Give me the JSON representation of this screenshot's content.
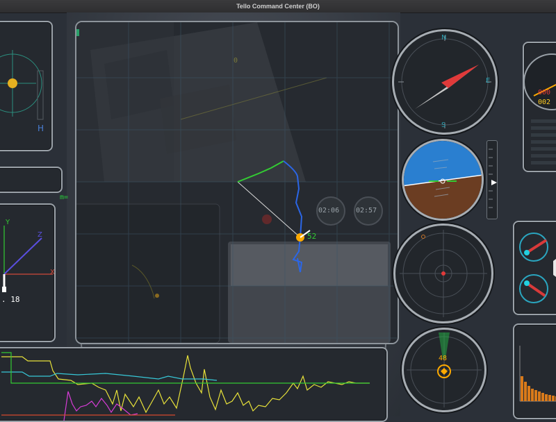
{
  "window": {
    "title": "Tello Command Center (BO)"
  },
  "heading_panel": {
    "label": "H"
  },
  "axes_panel": {
    "x_label": "X",
    "y_label": "Y",
    "z_label": "Z",
    "value": ". 18"
  },
  "map": {
    "m_label": "m=",
    "video_label": "0",
    "timer1": "02:06",
    "timer2": "02:57",
    "drone_value": "52",
    "path_color": "#2b66e6",
    "path_start_color": "#22cc44",
    "drone_color": "#ffaa00"
  },
  "compass": {
    "north": "N",
    "east": "E",
    "south": "S"
  },
  "gauge": {
    "top_digits": "000",
    "bottom_digits": "002"
  },
  "sonar": {
    "value": "48"
  },
  "telemetry_chart": {
    "series_colors": [
      "#e8e23a",
      "#37c8d8",
      "#33cc33",
      "#d63cd6",
      "#d84a2e"
    ]
  }
}
